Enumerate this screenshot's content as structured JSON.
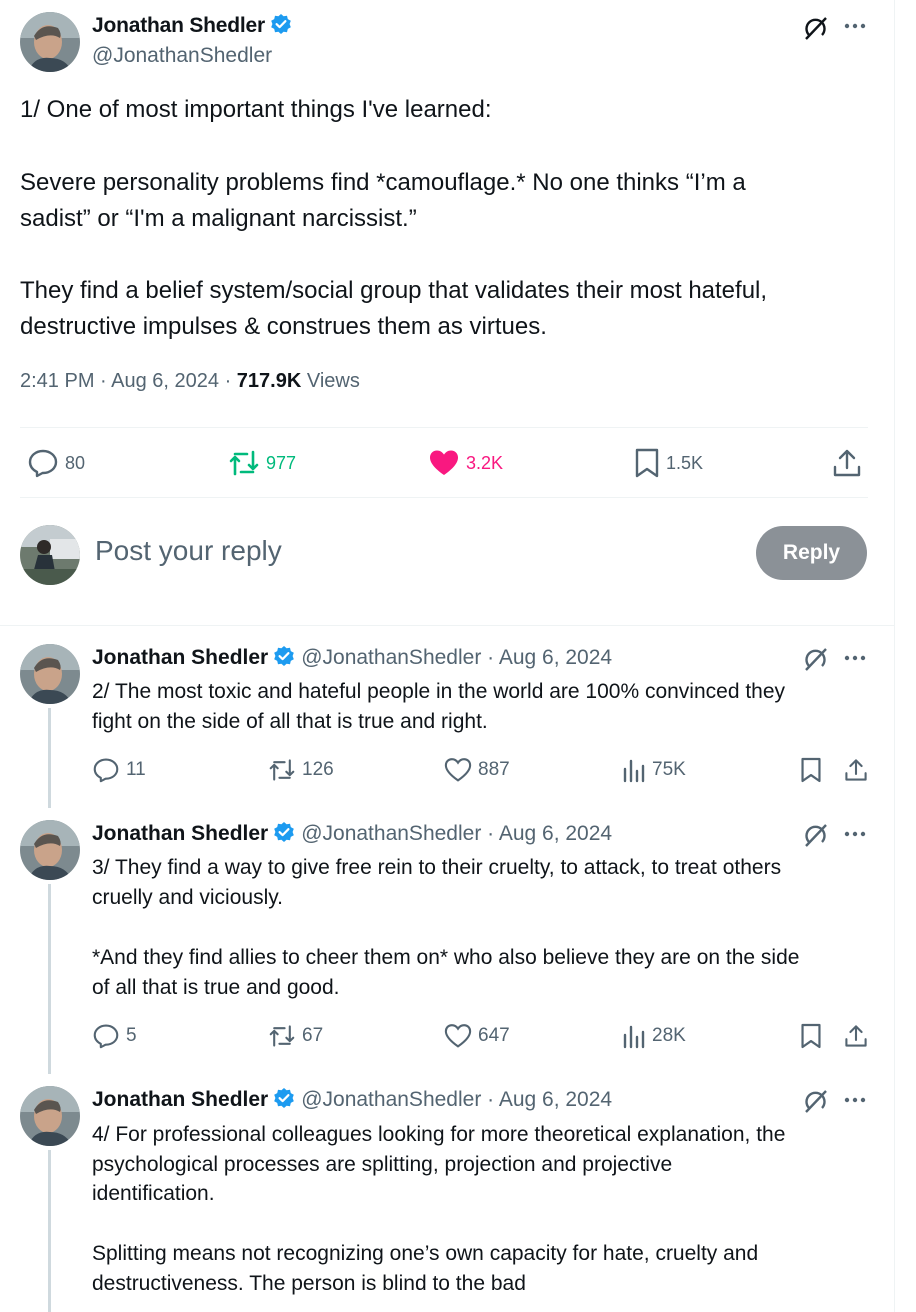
{
  "main_tweet": {
    "author_name": "Jonathan Shedler",
    "author_handle": "@JonathanShedler",
    "text_lines": [
      "1/ One of most important things I've learned:",
      "Severe personality problems find *camouflage.* No one thinks “I’m a",
      "sadist” or “I'm a malignant narcissist.”",
      "They find a belief system/social group that validates their most hateful,",
      "destructive impulses & construes them as virtues."
    ],
    "timestamp": "2:41 PM · Aug 6, 2024 · ",
    "views_count": "717.9K",
    "views_label": " Views",
    "replies": "80",
    "reposts": "977",
    "likes": "3.2K",
    "bookmarks": "1.5K"
  },
  "composer": {
    "placeholder": "Post your reply",
    "button_label": "Reply"
  },
  "replies": [
    {
      "author_name": "Jonathan Shedler",
      "author_handle": "@JonathanShedler · Aug 6, 2024",
      "lines": [
        "2/ The most toxic and hateful people in the world are 100% convinced they",
        "fight on the side of all that is true and right."
      ],
      "replies": "11",
      "reposts": "126",
      "likes": "887",
      "views": "75K"
    },
    {
      "author_name": "Jonathan Shedler",
      "author_handle": "@JonathanShedler · Aug 6, 2024",
      "lines": [
        "3/ They find a way to give free rein to their cruelty, to attack, to treat others",
        "cruelly and viciously.",
        "*And they find allies to cheer them on* who also believe they are on the side",
        "of all that is true and good."
      ],
      "replies": "5",
      "reposts": "67",
      "likes": "647",
      "views": "28K"
    },
    {
      "author_name": "Jonathan Shedler",
      "author_handle": "@JonathanShedler · Aug 6, 2024",
      "lines": [
        "4/ For professional colleagues looking for more  theoretical explanation, the",
        "psychological processes are splitting, projection and projective",
        "identification.",
        "Splitting means not recognizing one’s own capacity for hate, cruelty and",
        "destructiveness. The person is blind to the bad"
      ]
    }
  ],
  "colors": {
    "verified": "#1d9bf0",
    "repost_active": "#00ba7c",
    "like_active": "#f91880",
    "secondary_text": "#536471",
    "reply_button": "#8b9197"
  },
  "icons": {
    "verified": "verified-badge-icon",
    "grok": "grok-icon",
    "more": "more-icon",
    "reply": "reply-icon",
    "repost": "repost-icon",
    "like": "heart-icon",
    "views": "views-icon",
    "bookmark": "bookmark-icon",
    "share": "share-icon"
  }
}
